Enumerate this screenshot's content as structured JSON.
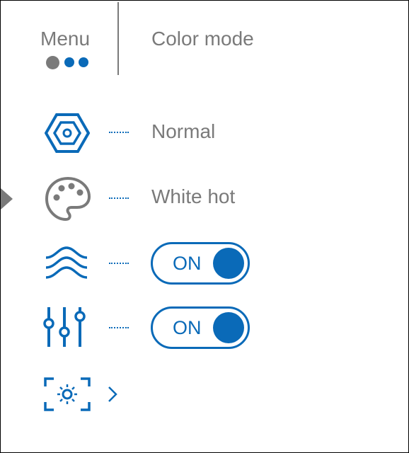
{
  "header": {
    "menu_label": "Menu",
    "title": "Color mode",
    "page_dots": {
      "active_index": 0,
      "count": 3
    }
  },
  "rows": [
    {
      "icon": "hexagon-nut-icon",
      "value": "Normal"
    },
    {
      "icon": "palette-icon",
      "value": "White hot"
    },
    {
      "icon": "waves-icon",
      "toggle_label": "ON"
    },
    {
      "icon": "sliders-icon",
      "toggle_label": "ON"
    },
    {
      "icon": "focus-brightness-icon",
      "arrow": "chevron-right-icon"
    }
  ],
  "colors": {
    "accent": "#0a6ab8",
    "text_gray": "#7a7a7a"
  }
}
